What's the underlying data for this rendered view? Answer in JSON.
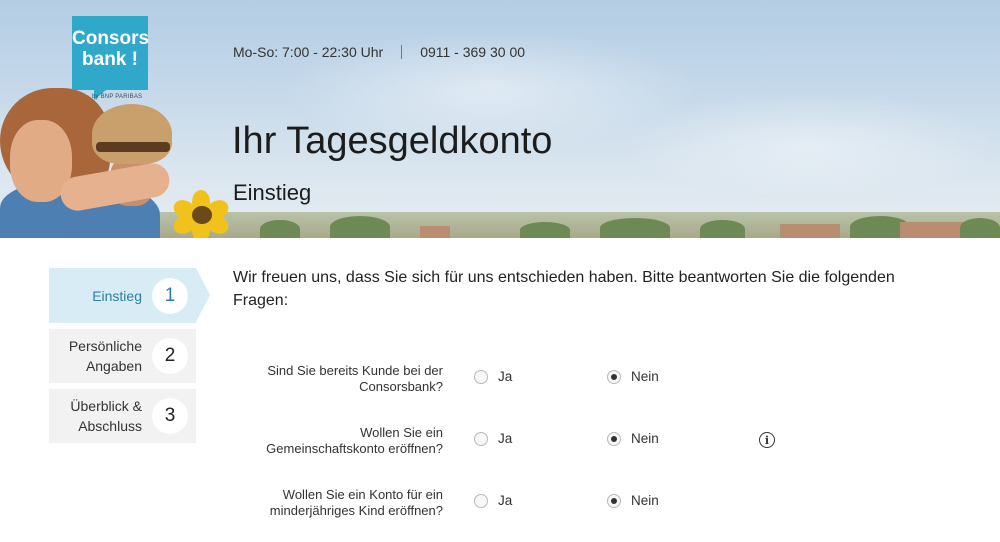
{
  "brand": {
    "logo_line1": "Consors",
    "logo_line2": "bank !",
    "logo_sub": "by BNP PARIBAS",
    "color": "#2fa8c9"
  },
  "header": {
    "hours": "Mo-So: 7:00 - 22:30 Uhr",
    "phone": "0911 - 369 30 00",
    "title": "Ihr Tagesgeldkonto",
    "subtitle": "Einstieg"
  },
  "steps": [
    {
      "label": "Einstieg",
      "number": "1",
      "active": true
    },
    {
      "label_line1": "Persönliche",
      "label_line2": "Angaben",
      "number": "2",
      "active": false
    },
    {
      "label_line1": "Überblick &",
      "label_line2": "Abschluss",
      "number": "3",
      "active": false
    }
  ],
  "intro": "Wir freuen uns, dass Sie sich für uns entschieden haben. Bitte beantworten Sie die folgenden Fragen:",
  "questions": [
    {
      "line1": "Sind Sie bereits Kunde bei der",
      "line2": "Consorsbank?",
      "yes": "Ja",
      "no": "Nein",
      "selected": "Nein"
    },
    {
      "line1": "Wollen Sie ein",
      "line2": "Gemeinschaftskonto eröffnen?",
      "yes": "Ja",
      "no": "Nein",
      "selected": "Nein",
      "info_icon": "info-icon"
    },
    {
      "line1": "Wollen Sie ein Konto für ein",
      "line2": "minderjähriges Kind eröffnen?",
      "yes": "Ja",
      "no": "Nein",
      "selected": "Nein"
    }
  ],
  "icons": {
    "info": "i"
  }
}
